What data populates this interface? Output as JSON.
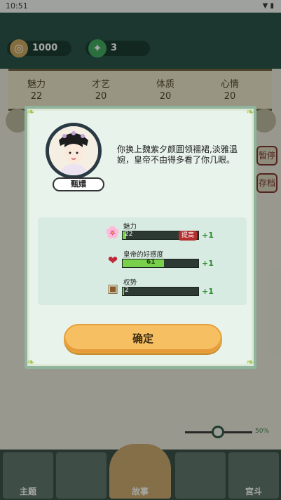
{
  "status_bar": {
    "time": "10:51",
    "icons": "▼ ▮"
  },
  "top_bar": {
    "coins": "1000",
    "jade": "3"
  },
  "stats": [
    {
      "label": "魅力",
      "value": "22"
    },
    {
      "label": "才艺",
      "value": "20"
    },
    {
      "label": "体质",
      "value": "20"
    },
    {
      "label": "心情",
      "value": "20"
    }
  ],
  "side_tags": {
    "pause": "暂停",
    "save": "存档"
  },
  "dialog": {
    "character_name": "甄嬛",
    "message": "你换上魏紫夕颜圆领襦裙,淡雅温婉，皇帝不由得多看了你几眼。",
    "changes": [
      {
        "label": "魅力",
        "value": "22",
        "badge": "提高",
        "delta": "+1",
        "icon": "flower-icon",
        "fill": 0.05,
        "color": "#79d04a"
      },
      {
        "label": "皇帝的好感度",
        "value": "61",
        "badge": "",
        "delta": "+1",
        "icon": "heart-icon",
        "fill": 0.55,
        "color": "#79d04a"
      },
      {
        "label": "权势",
        "value": "2",
        "badge": "",
        "delta": "+1",
        "icon": "power-icon",
        "fill": 0.02,
        "color": "#79d04a"
      }
    ],
    "confirm_label": "确定"
  },
  "bottom_nav": {
    "tabs": [
      "主题",
      "",
      "故事",
      "",
      "宫斗"
    ]
  },
  "speed": {
    "percent": "50%"
  }
}
